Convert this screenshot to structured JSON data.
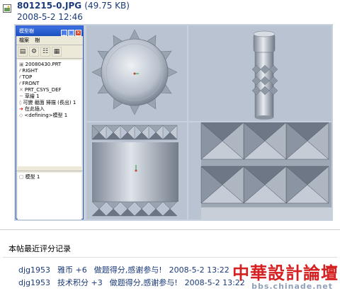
{
  "file": {
    "name": "801215-0.JPG",
    "size": "(49.75 KB)",
    "date": "2008-5-2 12:46"
  },
  "tree_window": {
    "title": "模型樹",
    "menu": [
      "檔案",
      "樹"
    ],
    "items": [
      {
        "label": "20080430.PRT",
        "icon": "part-icon"
      },
      {
        "label": "RIGHT",
        "icon": "datum-plane-icon"
      },
      {
        "label": "TOP",
        "icon": "datum-plane-icon"
      },
      {
        "label": "FRONT",
        "icon": "datum-plane-icon"
      },
      {
        "label": "PRT_CSYS_DEF",
        "icon": "csys-icon"
      },
      {
        "label": "草繪 1",
        "icon": "sketch-icon"
      },
      {
        "label": "可變 截面 掃描 (長出) 1",
        "icon": "sweep-icon"
      },
      {
        "label": "在此插入",
        "icon": "insert-icon"
      },
      {
        "label": "<defining>模型 1",
        "icon": "defining-icon"
      }
    ],
    "lower_items": [
      {
        "label": "模型 1",
        "icon": "model-icon"
      }
    ]
  },
  "records": {
    "title": "本帖最近评分记录",
    "rows": [
      {
        "user": "djg1953",
        "item": "雅币 +6",
        "reason": "做题得分,感谢参与!",
        "time": "2008-5-2 13:22"
      },
      {
        "user": "djg1953",
        "item": "技术积分 +3",
        "reason": "做题得分,感谢参与!",
        "time": "2008-5-2 13:22"
      }
    ]
  },
  "watermark": {
    "main": "中華設計論壇",
    "url": "bbs.chinade.net"
  },
  "colors": {
    "link": "#1a3a7a",
    "title_bar": "#2a54c8",
    "viewport": "#b9c3d1",
    "watermark": "#d42020"
  }
}
